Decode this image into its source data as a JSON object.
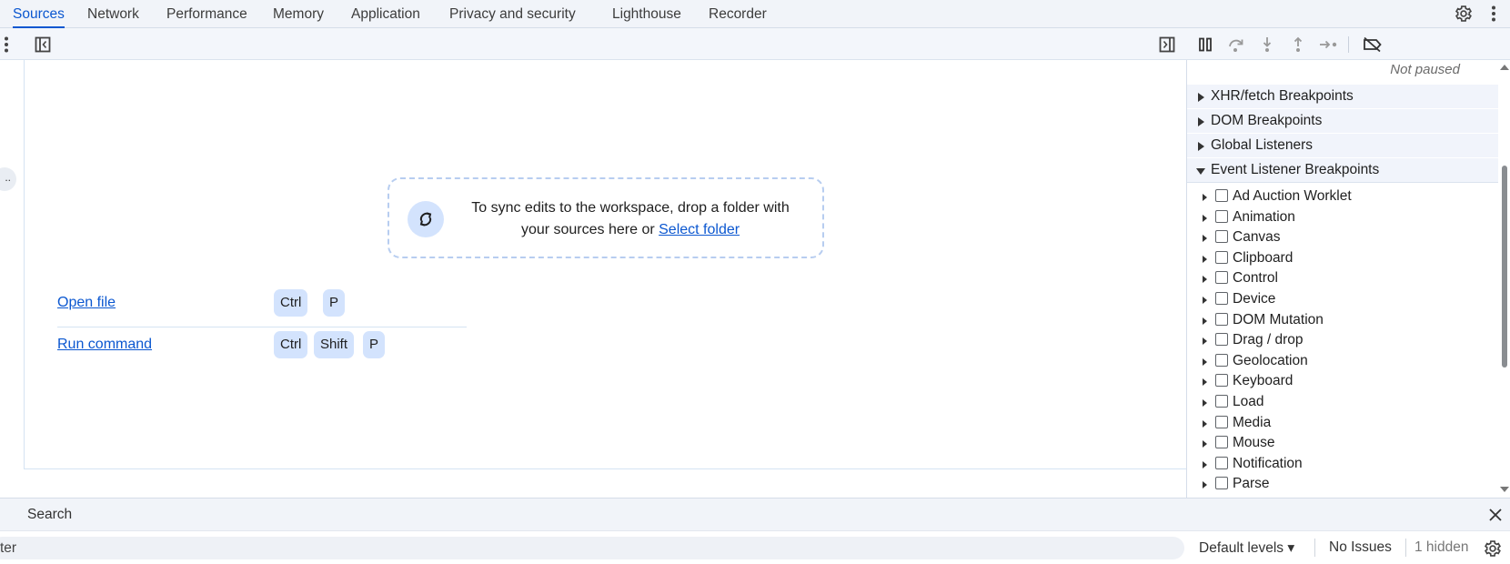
{
  "tabs": [
    {
      "label": "Sources",
      "active": true
    },
    {
      "label": "Network"
    },
    {
      "label": "Performance"
    },
    {
      "label": "Memory"
    },
    {
      "label": "Application"
    },
    {
      "label": "Privacy and security"
    },
    {
      "label": "Lighthouse"
    },
    {
      "label": "Recorder"
    }
  ],
  "top_icons": [
    "gear-icon",
    "more-vert-icon"
  ],
  "toolbar_icons": [
    "more-vert-icon",
    "toggle-navigator-icon",
    "toggle-debugger-icon",
    "pause-icon",
    "step-over-icon",
    "step-into-icon",
    "step-out-icon",
    "step-icon",
    "deactivate-breakpoints-icon"
  ],
  "editor": {
    "collapsed_label": "..",
    "drop_text_before": "To sync edits to the workspace, drop a folder with your sources here or ",
    "drop_link": "Select folder",
    "shortcuts": [
      {
        "label": "Open file",
        "keys": [
          "Ctrl",
          "P"
        ]
      },
      {
        "label": "Run command",
        "keys": [
          "Ctrl",
          "Shift",
          "P"
        ]
      }
    ]
  },
  "debugger": {
    "status": "Not paused",
    "sections": [
      {
        "label": "XHR/fetch Breakpoints",
        "expanded": false
      },
      {
        "label": "DOM Breakpoints",
        "expanded": false
      },
      {
        "label": "Global Listeners",
        "expanded": false
      },
      {
        "label": "Event Listener Breakpoints",
        "expanded": true
      }
    ],
    "event_listeners": [
      "Ad Auction Worklet",
      "Animation",
      "Canvas",
      "Clipboard",
      "Control",
      "Device",
      "DOM Mutation",
      "Drag / drop",
      "Geolocation",
      "Keyboard",
      "Load",
      "Media",
      "Mouse",
      "Notification",
      "Parse"
    ]
  },
  "drawer": {
    "title": "Search",
    "filter_text": "ter",
    "levels": "Default levels ▾",
    "issues": "No Issues",
    "hidden": "1 hidden"
  },
  "colors": {
    "accent": "#0b57d0",
    "chip": "#d3e3fd",
    "tabbar": "#f1f4f9"
  }
}
